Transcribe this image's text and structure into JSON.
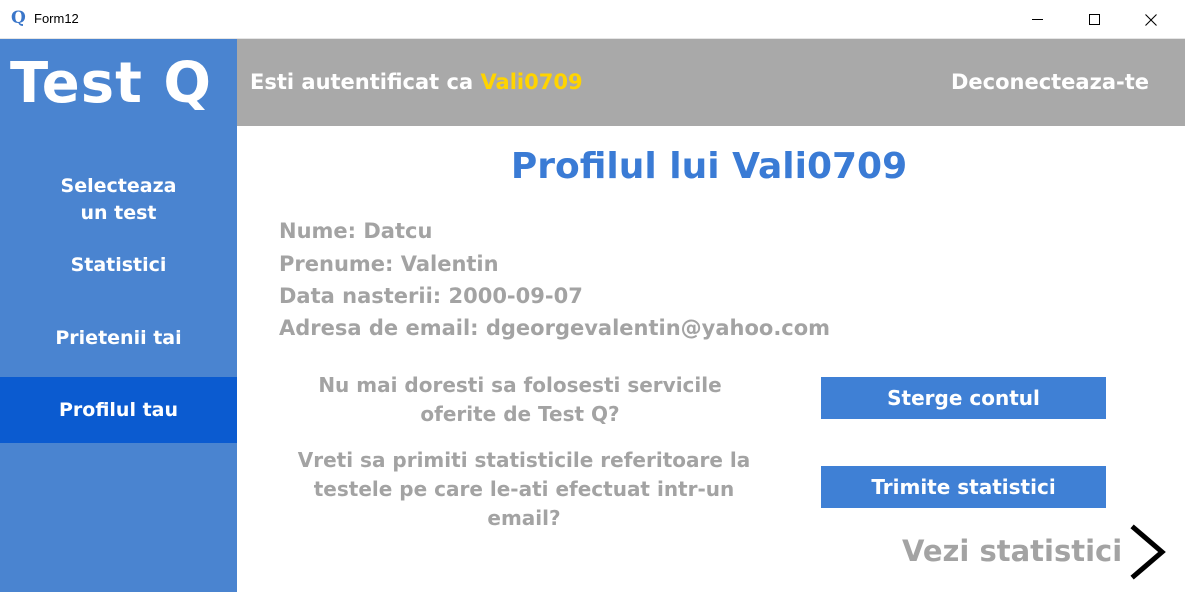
{
  "window": {
    "title": "Form12",
    "icon_glyph": "Q",
    "icon_name": "app-q-icon",
    "controls": [
      "minimize-icon",
      "maximize-icon",
      "close-icon"
    ]
  },
  "sidebar": {
    "logo": "Test Q",
    "items": [
      {
        "label_line1": "Selecteaza",
        "label_line2": "un test"
      },
      {
        "label": "Statistici"
      },
      {
        "label": "Prietenii tai"
      },
      {
        "label": "Profilul tau",
        "active": true
      }
    ]
  },
  "header": {
    "auth_prefix": "Esti autentificat ca ",
    "username": "Vali0709",
    "logout_label": "Deconecteaza-te"
  },
  "profile": {
    "title": "Profilul lui Vali0709",
    "nume": "Nume: Datcu",
    "prenume": "Prenume: Valentin",
    "data_nasterii": "Data nasterii: 2000-09-07",
    "email": "Adresa de email: dgeorgevalentin@yahoo.com"
  },
  "actions": {
    "delete_question_line1": "Nu mai doresti sa folosesti servicile",
    "delete_question_line2": "oferite de Test Q?",
    "delete_button": "Sterge contul",
    "stats_question_line1": "Vreti sa primiti statisticile referitoare la",
    "stats_question_line2": "testele pe care le-ati efectuat intr-un",
    "stats_question_line3": "email?",
    "stats_button": "Trimite statistici",
    "view_stats": "Vezi statistici",
    "view_stats_icon": "chevron-right-icon"
  },
  "colors": {
    "sidebar": "#4a84d0",
    "sidebar_active": "#0b5bd0",
    "header": "#a9a9a9",
    "username_accent": "#ffd400",
    "title_blue": "#3a7bd5",
    "muted_text": "#a3a3a3",
    "button_blue": "#3f80d5"
  }
}
